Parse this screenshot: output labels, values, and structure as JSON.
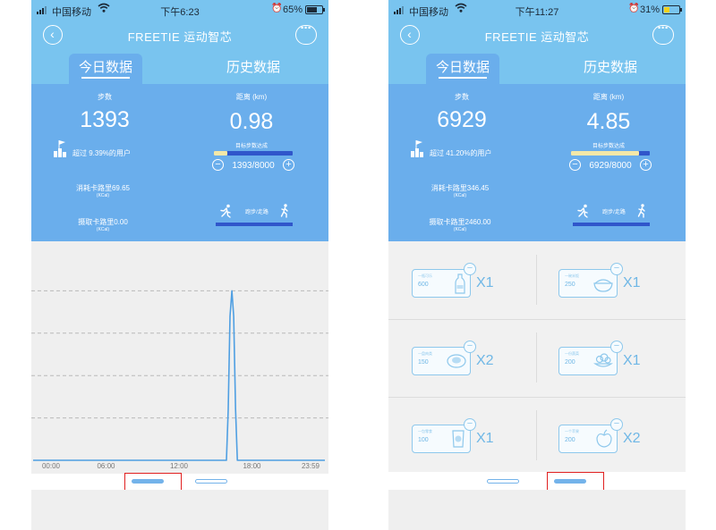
{
  "left": {
    "status": {
      "carrier": "中国移动",
      "time": "下午6:23",
      "battery": "65%",
      "battery_level": 0.65
    },
    "nav": {
      "title": "FREETIE 运动智芯",
      "back_icon": "back-arrow-icon",
      "more_icon": "ellipsis-icon"
    },
    "tabs": [
      {
        "label": "今日数据",
        "active": true
      },
      {
        "label": "历史数据",
        "active": false
      }
    ],
    "steps": {
      "label": "步数",
      "value": "1393",
      "beat": "超过 9.39%的用户"
    },
    "distance": {
      "label": "距离 (km)",
      "value": "0.98",
      "goal_label": "目标步数达成",
      "goal_text": "1393/8000",
      "progress": 0.174
    },
    "calories": {
      "burn_label": "消耗卡路里69.65",
      "burn_unit": "(KCal)",
      "intake_label": "摄取卡路里0.00",
      "intake_unit": "(KCal)"
    },
    "mode": {
      "label": "跑步/走路"
    },
    "chart_data": {
      "type": "line",
      "title": "",
      "xlabel": "",
      "ylabel": "",
      "x_ticks": [
        "00:00",
        "06:00",
        "12:00",
        "18:00",
        "23:59"
      ],
      "x": [
        0,
        14,
        15.9,
        16.05,
        16.2,
        16.35,
        16.5,
        16.65,
        16.8,
        17.0,
        24
      ],
      "y": [
        0,
        0,
        0,
        0.3,
        0.85,
        1.0,
        0.85,
        0.3,
        0,
        0,
        0
      ],
      "ylim": [
        0,
        1.25
      ],
      "grid": true
    },
    "pager": {
      "pages": 2,
      "active": 0
    }
  },
  "right": {
    "status": {
      "carrier": "中国移动",
      "time": "下午11:27",
      "battery": "31%",
      "battery_level": 0.31
    },
    "nav": {
      "title": "FREETIE 运动智芯",
      "back_icon": "back-arrow-icon",
      "more_icon": "ellipsis-icon"
    },
    "tabs": [
      {
        "label": "今日数据",
        "active": true
      },
      {
        "label": "历史数据",
        "active": false
      }
    ],
    "steps": {
      "label": "步数",
      "value": "6929",
      "beat": "超过 41.20%的用户"
    },
    "distance": {
      "label": "距离 (km)",
      "value": "4.85",
      "goal_label": "目标步数达成",
      "goal_text": "6929/8000",
      "progress": 0.866
    },
    "calories": {
      "burn_label": "消耗卡路里346.45",
      "burn_unit": "(KCal)",
      "intake_label": "摄取卡路里2460.00",
      "intake_unit": "(KCal)"
    },
    "mode": {
      "label": "跑步/走路"
    },
    "foods": [
      {
        "name": "一瓶可乐",
        "kcal": "600",
        "qty": "X1",
        "icon": "cola-bottle-icon"
      },
      {
        "name": "一碗米饭",
        "kcal": "250",
        "qty": "X1",
        "icon": "rice-bowl-icon"
      },
      {
        "name": "一盘肉类",
        "kcal": "150",
        "qty": "X2",
        "icon": "meat-plate-icon"
      },
      {
        "name": "一份蔬菜",
        "kcal": "200",
        "qty": "X1",
        "icon": "vegetable-icon"
      },
      {
        "name": "一包零食",
        "kcal": "100",
        "qty": "X1",
        "icon": "snack-bag-icon"
      },
      {
        "name": "一个苹果",
        "kcal": "200",
        "qty": "X2",
        "icon": "apple-icon"
      }
    ],
    "pager": {
      "pages": 2,
      "active": 1
    }
  }
}
